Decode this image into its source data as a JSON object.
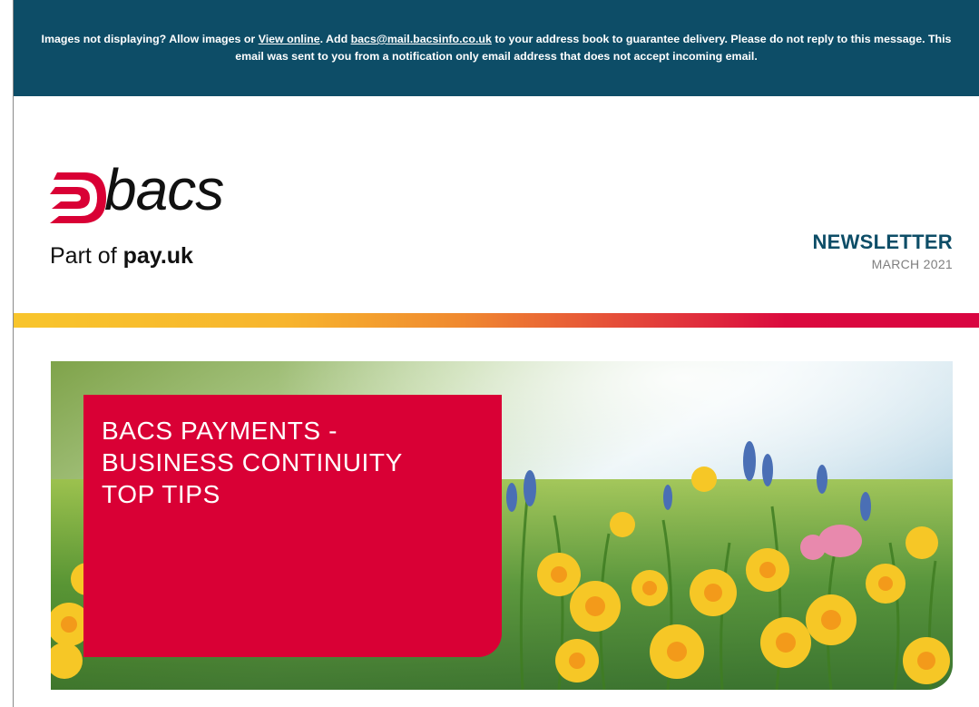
{
  "banner": {
    "prefix": "Images not displaying? Allow images or ",
    "view_online_link": "View online",
    "mid": ". Add ",
    "email_link": "bacs@mail.bacsinfo.co.uk",
    "suffix": " to your address book to guarantee delivery. Please do not reply to this message. This email was sent to you from a notification only email address that does not accept incoming email."
  },
  "logo": {
    "wordmark": "bacs",
    "tagline_prefix": "Part of ",
    "tagline_brand": "pay.uk"
  },
  "header": {
    "title": "NEWSLETTER",
    "date": "MARCH 2021"
  },
  "hero": {
    "title_lines": [
      "BACS PAYMENTS -",
      "BUSINESS CONTINUITY",
      "TOP TIPS"
    ]
  },
  "colors": {
    "banner_bg": "#0d4d67",
    "brand_red": "#d90035",
    "accent_yellow": "#f8c52c"
  }
}
